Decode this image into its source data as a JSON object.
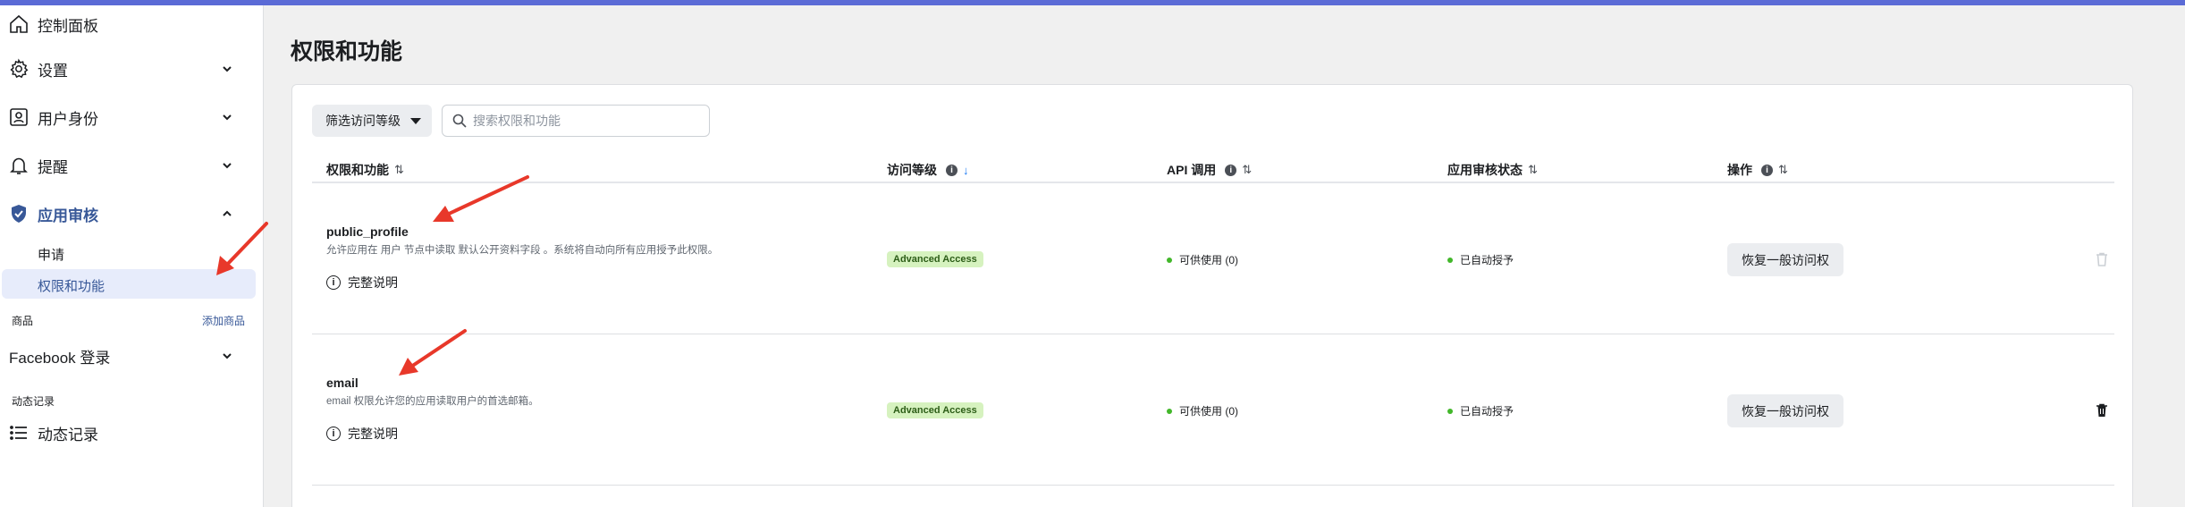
{
  "sidebar": {
    "dashboard": "控制面板",
    "settings": "设置",
    "user_roles": "用户身份",
    "alerts": "提醒",
    "app_review": "应用审核",
    "app_review_items": [
      "申请",
      "权限和功能"
    ],
    "products_section": "商品",
    "add_product": "添加商品",
    "facebook_login": "Facebook 登录",
    "activity_section": "动态记录",
    "activity_log": "动态记录"
  },
  "main": {
    "title": "权限和功能",
    "filter_label": "筛选访问等级",
    "search_placeholder": "搜索权限和功能",
    "columns": [
      "权限和功能",
      "访问等级",
      "API 调用",
      "应用审核状态",
      "操作"
    ],
    "rows": [
      {
        "name": "public_profile",
        "description": "允许应用在 用户 节点中读取 默认公开资料字段 。系统将自动向所有应用授予此权限。",
        "doc_link": "完整说明",
        "access": "Advanced Access",
        "api_calls": "可供使用 (0)",
        "review_status": "已自动授予",
        "action": "恢复一般访问权"
      },
      {
        "name": "email",
        "description": "email 权限允许您的应用读取用户的首选邮箱。",
        "doc_link": "完整说明",
        "access": "Advanced Access",
        "api_calls": "可供使用 (0)",
        "review_status": "已自动授予",
        "action": "恢复一般访问权"
      }
    ]
  },
  "colors": {
    "accent": "#5b6bd6",
    "link": "#385898",
    "active_nav": "#1877f2",
    "badge_bg": "#d6f2bf",
    "status_dot": "#42b72a",
    "annotation_arrow": "#e8382a"
  }
}
